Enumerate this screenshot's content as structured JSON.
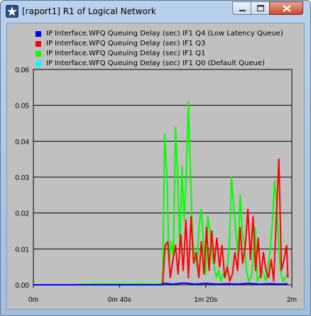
{
  "window": {
    "title": "[raport1] R1 of Logical Network",
    "icons": {
      "app": "opnet-star-icon",
      "minimize": "minimize-icon",
      "maximize": "maximize-icon",
      "close": "close-icon"
    }
  },
  "chart_data": {
    "type": "line",
    "xlabel": "",
    "ylabel": "",
    "xlim": [
      0,
      120
    ],
    "ylim": [
      0,
      0.06
    ],
    "x_ticks": [
      {
        "value": 0,
        "label": "0m"
      },
      {
        "value": 40,
        "label": "0m 40s"
      },
      {
        "value": 80,
        "label": "1m 20s"
      },
      {
        "value": 120,
        "label": "2m"
      }
    ],
    "y_ticks": [
      {
        "value": 0,
        "label": "0.00"
      },
      {
        "value": 0.01,
        "label": "0.01"
      },
      {
        "value": 0.02,
        "label": "0.02"
      },
      {
        "value": 0.03,
        "label": "0.03"
      },
      {
        "value": 0.04,
        "label": "0.04"
      },
      {
        "value": 0.05,
        "label": "0.05"
      },
      {
        "value": 0.06,
        "label": "0.06"
      }
    ],
    "grid": "horizontal",
    "legend_position": "top",
    "series": [
      {
        "name": "IP Interface.WFQ Queuing Delay (sec) IF1 Q4 (Low Latency Queue)",
        "color": "#0000ff",
        "x": [
          0,
          20,
          40,
          60,
          60.5,
          65,
          70,
          75,
          80,
          85,
          90,
          95,
          100,
          105,
          110,
          115,
          118
        ],
        "y": [
          0,
          0,
          0,
          0,
          0.0004,
          0.0002,
          0.0005,
          0.0002,
          0.0004,
          0.0002,
          0.0003,
          0.0002,
          0.0004,
          0.0002,
          0.0003,
          0.0002,
          0.0003
        ]
      },
      {
        "name": "IP Interface.WFQ Queuing Delay (sec) IF1 Q3",
        "color": "#ff0000",
        "x": [
          60,
          61.2,
          62.4,
          63.6,
          64.8,
          66,
          67.2,
          68.4,
          69.6,
          70.8,
          72,
          73.2,
          74.4,
          75.6,
          76.8,
          78,
          79.2,
          80.4,
          81.6,
          82.8,
          84,
          85.2,
          86.4,
          87.6,
          88.8,
          90,
          91.2,
          92.4,
          93.6,
          94.8,
          96,
          97.2,
          98.4,
          99.6,
          100.8,
          102,
          103.2,
          104.4,
          105.6,
          106.8,
          108,
          109.2,
          110.4,
          111.6,
          112.8,
          114,
          115.2,
          116.4,
          117.6,
          118.2
        ],
        "y": [
          0,
          0.011,
          0.012,
          0.002,
          0.007,
          0.011,
          0.003,
          0.014,
          0.004,
          0.018,
          0.002,
          0.019,
          0.006,
          0.009,
          0.002,
          0.012,
          0.003,
          0.016,
          0.004,
          0.015,
          0.006,
          0.013,
          0.005,
          0.011,
          0.002,
          0.005,
          0.001,
          0.003,
          0.009,
          0.004,
          0.016,
          0.006,
          0.011,
          0.021,
          0.007,
          0.019,
          0.004,
          0.013,
          0.002,
          0.009,
          0.004,
          0.002,
          0.007,
          0.001,
          0.019,
          0.035,
          0.004,
          0.007,
          0.011,
          0.002
        ]
      },
      {
        "name": "IP Interface.WFQ Queuing Delay (sec) IF1 Q1",
        "color": "#00ff00",
        "x": [
          0,
          3,
          6,
          9,
          12,
          15,
          18,
          20,
          25,
          30,
          35,
          40,
          45,
          50,
          55,
          59,
          60,
          61,
          62,
          63,
          64,
          65,
          66,
          67,
          68,
          69,
          70,
          71,
          72,
          73,
          74,
          75,
          76,
          77,
          78,
          79,
          80,
          81,
          82,
          83,
          84,
          85,
          86,
          87,
          88,
          89,
          90,
          91,
          92,
          93,
          94,
          95,
          96,
          97,
          98,
          99,
          100,
          101,
          102,
          103,
          104,
          105,
          106,
          107,
          108,
          109,
          110,
          111,
          112,
          113,
          114,
          115,
          116,
          117,
          118
        ],
        "y": [
          0,
          0,
          0,
          0,
          0,
          0,
          0,
          0.0001,
          0.0002,
          0.0003,
          0.0002,
          0.0003,
          0.0002,
          0.0003,
          0.0002,
          0.0003,
          0.001,
          0.042,
          0.03,
          0.006,
          0.012,
          0.008,
          0.044,
          0.03,
          0.009,
          0.033,
          0.018,
          0.03,
          0.051,
          0.03,
          0.012,
          0.008,
          0.005,
          0.017,
          0.021,
          0.012,
          0.003,
          0.019,
          0.015,
          0.008,
          0.005,
          0.002,
          0.004,
          0.001,
          0.003,
          0.002,
          0.004,
          0.011,
          0.03,
          0.022,
          0.015,
          0.008,
          0.025,
          0.015,
          0.011,
          0.004,
          0.001,
          0.002,
          0.006,
          0.016,
          0.001,
          0.002,
          0.004,
          0.003,
          0.001,
          0.005,
          0.01,
          0.018,
          0.029,
          0.022,
          0.009,
          0.003,
          0.001,
          0.002,
          0.003
        ]
      },
      {
        "name": "IP Interface.WFQ Queuing Delay (sec) IF1 Q0 (Default Queue)",
        "color": "#00ffff",
        "x": [
          0,
          10,
          18
        ],
        "y": [
          0,
          0,
          0
        ]
      }
    ]
  }
}
